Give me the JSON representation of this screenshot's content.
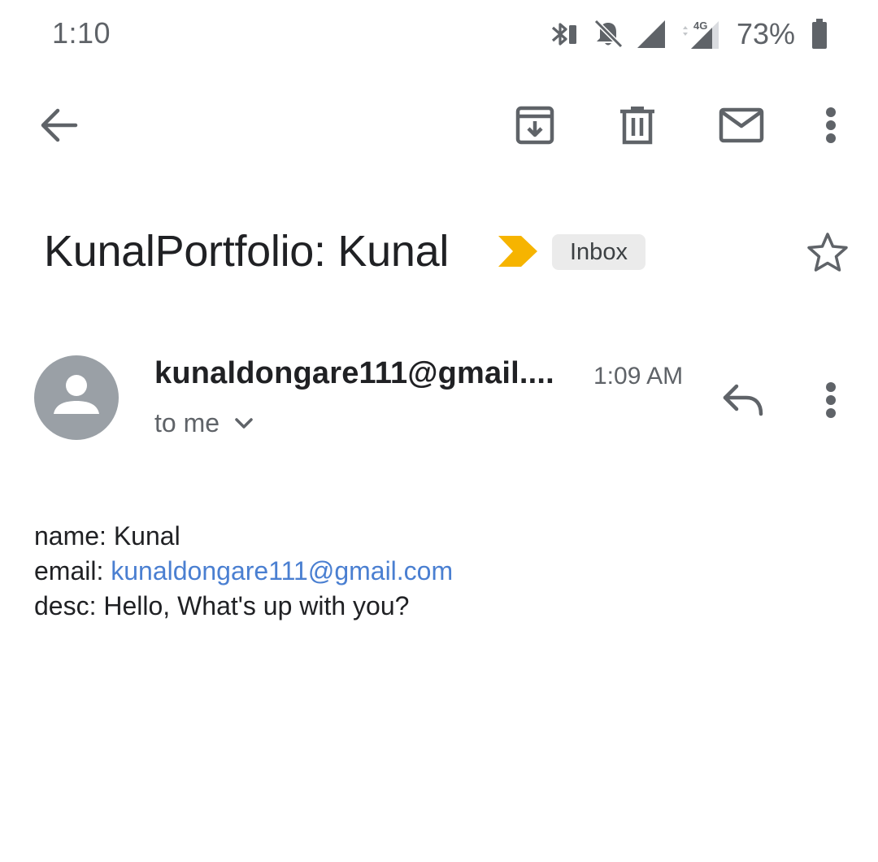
{
  "status_bar": {
    "time": "1:10",
    "network_type": "4G",
    "battery": "73%",
    "icons": [
      "bluetooth-icon",
      "notifications-off-icon",
      "signal-icon",
      "data-4g-icon",
      "battery-icon"
    ]
  },
  "toolbar": {
    "back_icon": "arrow-back-icon",
    "archive_icon": "archive-icon",
    "delete_icon": "delete-icon",
    "mark_unread_icon": "mail-icon",
    "more_icon": "more-vert-icon"
  },
  "email": {
    "subject": "KunalPortfolio: Kunal",
    "label": "Inbox",
    "sender": "kunaldongare111@gmail....",
    "time": "1:09 AM",
    "recipient": "to me",
    "body": {
      "name_label": "name:",
      "name_value": "Kunal",
      "email_label": "email:",
      "email_value": "kunaldongare111@gmail.com",
      "desc_label": "desc:",
      "desc_value": "Hello, What's up with you?"
    }
  },
  "colors": {
    "text": "#202124",
    "secondary_text": "#5f6368",
    "icon": "#5f6368",
    "importance_marker": "#f6b400",
    "chip_background": "#ebebeb",
    "avatar_background": "#9aa0a6",
    "link": "#4a7fd1"
  }
}
